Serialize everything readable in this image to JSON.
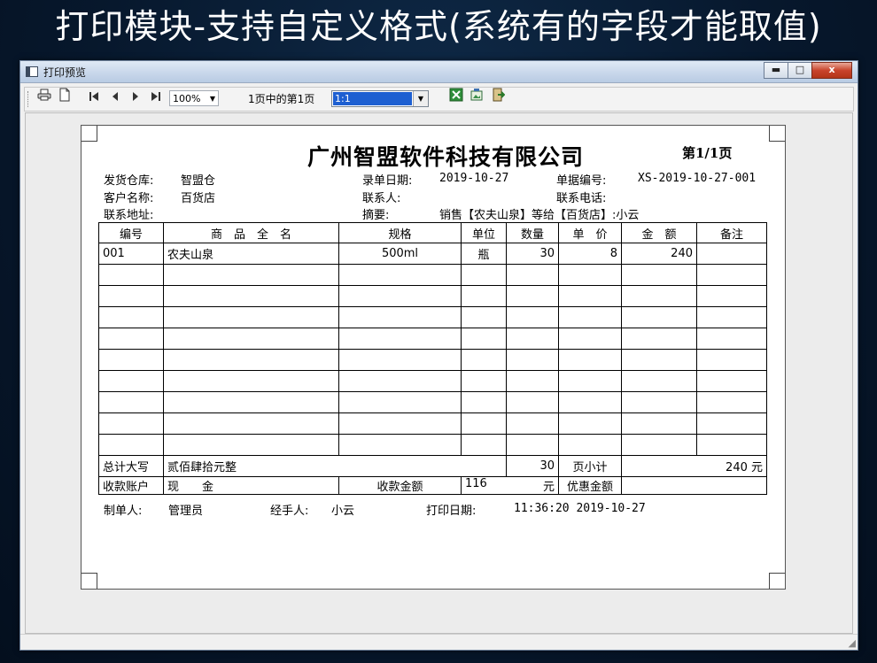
{
  "banner": "打印模块-支持自定义格式(系统有的字段才能取值)",
  "window": {
    "title": "打印预览",
    "buttons": {
      "minimize": "▬",
      "maximize": "□",
      "close": "x"
    }
  },
  "toolbar": {
    "zoom": "100%",
    "page_info": "1页中的第1页",
    "page_select": "1:1"
  },
  "document": {
    "company": "广州智盟软件科技有限公司",
    "page": "第1/1页",
    "fields": {
      "warehouse_label": "发货仓库:",
      "warehouse": "智盟仓",
      "date_label": "录单日期:",
      "date": "2019-10-27",
      "docno_label": "单据编号:",
      "docno": "XS-2019-10-27-001",
      "customer_label": "客户名称:",
      "customer": "百货店",
      "contact_label": "联系人:",
      "phone_label": "联系电话:",
      "address_label": "联系地址:",
      "summary_label": "摘要:",
      "summary": "销售【农夫山泉】等给【百货店】:小云"
    },
    "columns": [
      "编号",
      "商　品　全　名",
      "规格",
      "单位",
      "数量",
      "单　价",
      "金　额",
      "备注"
    ],
    "rows": [
      [
        "001",
        "农夫山泉",
        "500ml",
        "瓶",
        "30",
        "8",
        "240",
        ""
      ]
    ],
    "empty_rows": 9,
    "total_label": "总计大写",
    "total_text": "贰佰肆拾元整",
    "total_qty": "30",
    "subtotal_label": "页小计",
    "subtotal_value": "240  元",
    "account_label": "收款账户",
    "account_value": "现　　金",
    "received_label": "收款金额",
    "received_value": "116",
    "received_unit": "元",
    "discount_label": "优惠金额",
    "footer": {
      "maker_label": "制单人:",
      "maker": "管理员",
      "handler_label": "经手人:",
      "handler": "小云",
      "print_label": "打印日期:",
      "print_time": "11:36:20 2019-10-27"
    }
  }
}
